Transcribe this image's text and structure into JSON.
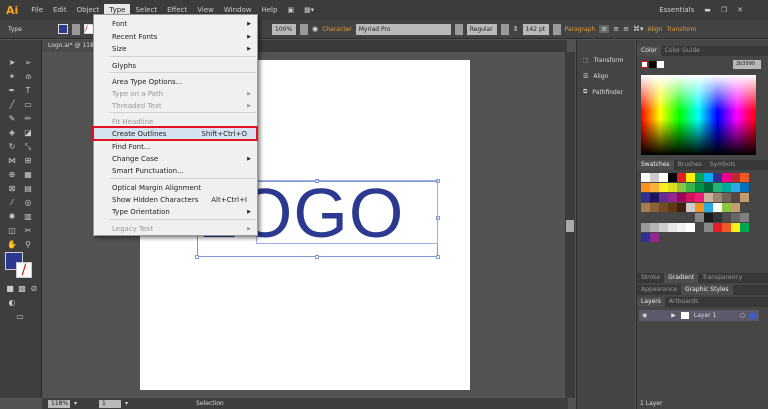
{
  "menubar": {
    "app_logo": "Ai",
    "items": [
      "File",
      "Edit",
      "Object",
      "Type",
      "Select",
      "Effect",
      "View",
      "Window",
      "Help"
    ],
    "active": "Type",
    "workspace": "Essentials"
  },
  "control": {
    "mode": "Type",
    "opacity": "100%",
    "character_link": "Character",
    "font": "Myriad Pro",
    "style": "Regular",
    "size": "142 pt",
    "paragraph_link": "Paragraph",
    "align_link": "Align",
    "transform_link": "Transform"
  },
  "document": {
    "tab": "Logo.ai* @ 118",
    "artwork_text": "LOGO",
    "artwork_color": "#2b3990"
  },
  "type_menu": {
    "items": [
      {
        "label": "Font",
        "submenu": true
      },
      {
        "label": "Recent Fonts",
        "submenu": true
      },
      {
        "label": "Size",
        "submenu": true
      },
      {
        "label": "Glyphs"
      },
      {
        "label": "Area Type Options..."
      },
      {
        "label": "Type on a Path",
        "disabled": true,
        "submenu": true
      },
      {
        "label": "Threaded Text",
        "disabled": true,
        "submenu": true
      },
      {
        "label": "Fit Headline",
        "disabled": true
      },
      {
        "label": "Create Outlines",
        "shortcut": "Shift+Ctrl+O",
        "highlighted": true
      },
      {
        "label": "Find Font..."
      },
      {
        "label": "Change Case",
        "submenu": true
      },
      {
        "label": "Smart Punctuation..."
      },
      {
        "label": "Optical Margin Alignment"
      },
      {
        "label": "Show Hidden Characters",
        "shortcut": "Alt+Ctrl+I"
      },
      {
        "label": "Type Orientation",
        "submenu": true
      },
      {
        "label": "Legacy Text",
        "disabled": true,
        "submenu": true
      }
    ],
    "highlight_color": "#e0141e"
  },
  "dock": {
    "items": [
      "Transform",
      "Align",
      "Pathfinder"
    ]
  },
  "panels": {
    "color_tabs": [
      "Color",
      "Color Guide"
    ],
    "hex": "2b3990",
    "swatch_tabs": [
      "Swatches",
      "Brushes",
      "Symbols"
    ],
    "stroke_tabs": [
      "Stroke",
      "Gradient",
      "Transparency"
    ],
    "appearance_tabs": [
      "Appearance",
      "Graphic Styles"
    ],
    "layer_tabs": [
      "Layers",
      "Artboards"
    ],
    "layer_name": "Layer 1",
    "layer_count": "1 Layer"
  },
  "status": {
    "zoom": "118%",
    "page": "1",
    "tool": "Selection"
  }
}
